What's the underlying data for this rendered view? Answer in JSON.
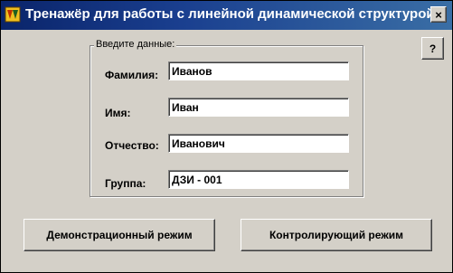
{
  "window": {
    "title": "Тренажёр для работы с линейной динамической структурой",
    "close_glyph": "×",
    "icon": "app-icon",
    "title_color": "#0a246a"
  },
  "help": {
    "label": "?"
  },
  "form": {
    "caption": "Введите данные:",
    "fields": [
      {
        "label": "Фамилия:",
        "value": "Иванов"
      },
      {
        "label": "Имя:",
        "value": "Иван"
      },
      {
        "label": "Отчество:",
        "value": "Иванович"
      },
      {
        "label": "Группа:",
        "value": "ДЗИ - 001"
      }
    ]
  },
  "buttons": {
    "demo": "Демонстрационный режим",
    "control": "Контролирующий режим"
  }
}
